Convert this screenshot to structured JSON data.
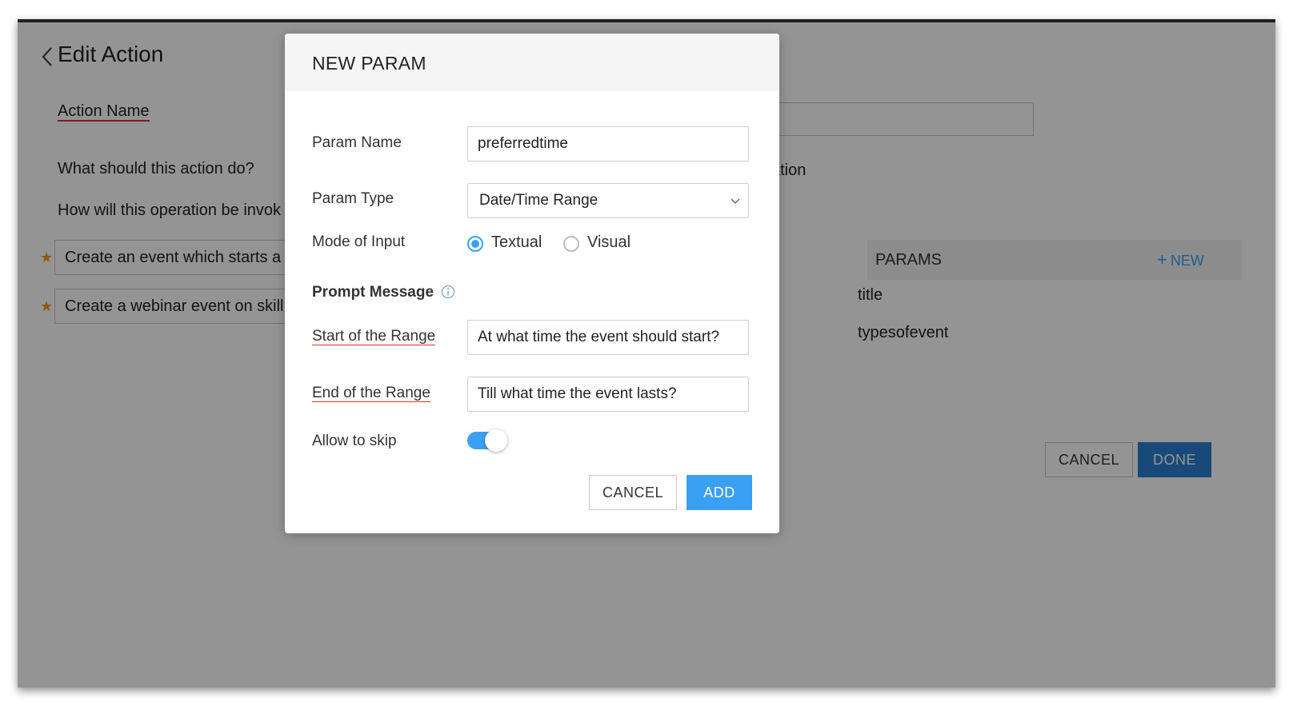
{
  "page": {
    "title": "Edit Action",
    "action_name_label": "Action Name",
    "what_label": "What should this action do?",
    "invoke_label": "How will this operation be invok",
    "hint_fragment": "ation",
    "utterances": [
      "Create an event which starts a",
      "Create a webinar event on skill"
    ],
    "params": {
      "header": "PARAMS",
      "new_label": "NEW",
      "items": [
        "title",
        "typesofevent"
      ]
    },
    "cancel_label": "CANCEL",
    "done_label": "DONE"
  },
  "modal": {
    "title": "NEW PARAM",
    "param_name": {
      "label": "Param Name",
      "value": "preferredtime"
    },
    "param_type": {
      "label": "Param Type",
      "value": "Date/Time Range"
    },
    "mode_of_input": {
      "label": "Mode of Input",
      "options": [
        "Textual",
        "Visual"
      ],
      "selected": "Textual"
    },
    "prompt_message_label": "Prompt Message",
    "start_range": {
      "label": "Start of the Range",
      "value": "At what time the event should start?"
    },
    "end_range": {
      "label": "End of the Range",
      "value": "Till what time the event lasts?"
    },
    "allow_skip": {
      "label": "Allow to skip",
      "enabled": true
    },
    "cancel_label": "CANCEL",
    "add_label": "ADD"
  },
  "colors": {
    "accent": "#3aa0f2",
    "done_button": "#2a7fd0",
    "star": "#e8a21d",
    "underline": "#d9342b"
  }
}
